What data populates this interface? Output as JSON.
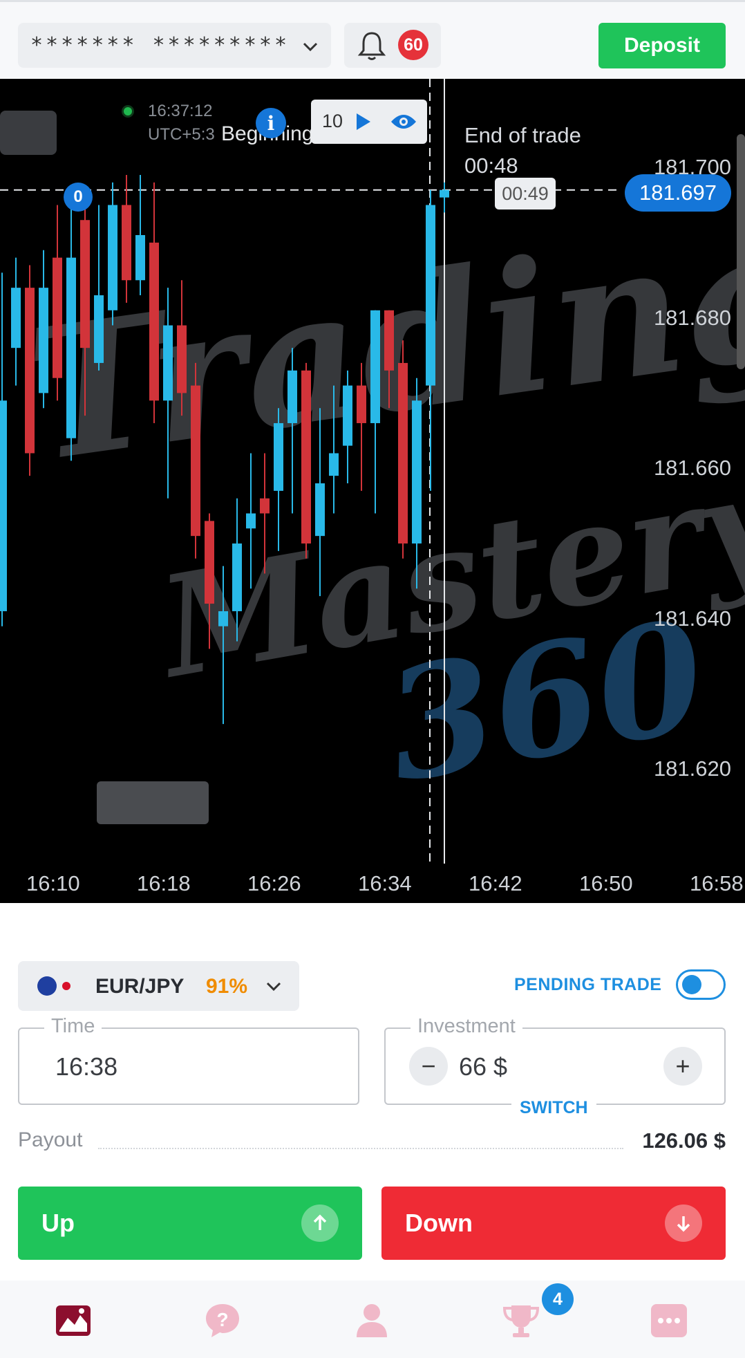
{
  "header": {
    "account_mask": "******* *********",
    "notification_count": "60",
    "deposit_label": "Deposit"
  },
  "chart_overlay": {
    "clock_time": "16:37:12",
    "clock_zone": "UTC+5:3",
    "beginning_label": "Beginning of trade",
    "speed_value": "10",
    "end_of_trade_label": "End of trade",
    "end_of_trade_time": "00:48",
    "timer_badge": "00:49",
    "current_price": "181.697",
    "marker_badge": "0",
    "watermark_line1": "Trading",
    "watermark_line2": "Mastery",
    "watermark_line3": "360"
  },
  "chart_data": {
    "type": "candlestick",
    "y_ticks": [
      "181.700",
      "181.680",
      "181.660",
      "181.640",
      "181.620"
    ],
    "x_ticks": [
      "16:10",
      "16:18",
      "16:26",
      "16:34",
      "16:42",
      "16:50",
      "16:58"
    ],
    "ylim": [
      181.6125,
      181.7035
    ],
    "current_price": 181.697,
    "colors": {
      "up": "#29b9e8",
      "down": "#d2343a"
    },
    "candles": [
      {
        "dir": "up",
        "o": 181.641,
        "c": 181.669,
        "h": 181.686,
        "l": 181.639
      },
      {
        "dir": "up",
        "o": 181.676,
        "c": 181.684,
        "h": 181.688,
        "l": 181.671
      },
      {
        "dir": "down",
        "o": 181.684,
        "c": 181.662,
        "h": 181.687,
        "l": 181.659
      },
      {
        "dir": "up",
        "o": 181.67,
        "c": 181.684,
        "h": 181.689,
        "l": 181.668
      },
      {
        "dir": "down",
        "o": 181.688,
        "c": 181.672,
        "h": 181.695,
        "l": 181.669
      },
      {
        "dir": "up",
        "o": 181.664,
        "c": 181.688,
        "h": 181.697,
        "l": 181.661
      },
      {
        "dir": "down",
        "o": 181.693,
        "c": 181.676,
        "h": 181.697,
        "l": 181.667
      },
      {
        "dir": "up",
        "o": 181.674,
        "c": 181.683,
        "h": 181.695,
        "l": 181.673
      },
      {
        "dir": "up",
        "o": 181.681,
        "c": 181.695,
        "h": 181.698,
        "l": 181.679
      },
      {
        "dir": "down",
        "o": 181.695,
        "c": 181.685,
        "h": 181.699,
        "l": 181.682
      },
      {
        "dir": "up",
        "o": 181.685,
        "c": 181.691,
        "h": 181.699,
        "l": 181.683
      },
      {
        "dir": "down",
        "o": 181.69,
        "c": 181.669,
        "h": 181.698,
        "l": 181.666
      },
      {
        "dir": "up",
        "o": 181.669,
        "c": 181.679,
        "h": 181.684,
        "l": 181.656
      },
      {
        "dir": "down",
        "o": 181.679,
        "c": 181.67,
        "h": 181.685,
        "l": 181.667
      },
      {
        "dir": "down",
        "o": 181.671,
        "c": 181.651,
        "h": 181.674,
        "l": 181.648
      },
      {
        "dir": "down",
        "o": 181.653,
        "c": 181.642,
        "h": 181.654,
        "l": 181.636
      },
      {
        "dir": "up",
        "o": 181.639,
        "c": 181.641,
        "h": 181.647,
        "l": 181.626
      },
      {
        "dir": "up",
        "o": 181.641,
        "c": 181.65,
        "h": 181.656,
        "l": 181.637
      },
      {
        "dir": "up",
        "o": 181.652,
        "c": 181.654,
        "h": 181.662,
        "l": 181.644
      },
      {
        "dir": "down",
        "o": 181.656,
        "c": 181.654,
        "h": 181.662,
        "l": 181.646
      },
      {
        "dir": "up",
        "o": 181.657,
        "c": 181.666,
        "h": 181.668,
        "l": 181.649
      },
      {
        "dir": "up",
        "o": 181.666,
        "c": 181.673,
        "h": 181.676,
        "l": 181.654
      },
      {
        "dir": "down",
        "o": 181.673,
        "c": 181.65,
        "h": 181.674,
        "l": 181.648
      },
      {
        "dir": "up",
        "o": 181.651,
        "c": 181.658,
        "h": 181.668,
        "l": 181.643
      },
      {
        "dir": "up",
        "o": 181.659,
        "c": 181.662,
        "h": 181.671,
        "l": 181.654
      },
      {
        "dir": "up",
        "o": 181.663,
        "c": 181.671,
        "h": 181.673,
        "l": 181.658
      },
      {
        "dir": "down",
        "o": 181.671,
        "c": 181.666,
        "h": 181.674,
        "l": 181.657
      },
      {
        "dir": "up",
        "o": 181.666,
        "c": 181.681,
        "h": 181.681,
        "l": 181.654
      },
      {
        "dir": "down",
        "o": 181.681,
        "c": 181.673,
        "h": 181.681,
        "l": 181.668
      },
      {
        "dir": "down",
        "o": 181.674,
        "c": 181.65,
        "h": 181.677,
        "l": 181.648
      },
      {
        "dir": "up",
        "o": 181.65,
        "c": 181.669,
        "h": 181.672,
        "l": 181.644
      },
      {
        "dir": "up",
        "o": 181.671,
        "c": 181.695,
        "h": 181.697,
        "l": 181.657
      },
      {
        "dir": "up",
        "o": 181.696,
        "c": 181.697,
        "h": 181.698,
        "l": 181.694
      }
    ]
  },
  "trade_panel": {
    "asset_name": "EUR/JPY",
    "asset_payout_pct": "91%",
    "pending_trade_label": "PENDING TRADE",
    "time_label": "Time",
    "time_value": "16:38",
    "investment_label": "Investment",
    "investment_value": "66 $",
    "minus_label": "−",
    "plus_label": "+",
    "switch_label": "SWITCH",
    "payout_label": "Payout",
    "payout_value": "126.06 $",
    "up_label": "Up",
    "down_label": "Down"
  },
  "tabbar": {
    "trophy_badge": "4",
    "active_color": "#8c0f2e",
    "inactive_color": "#f0b8c8"
  }
}
